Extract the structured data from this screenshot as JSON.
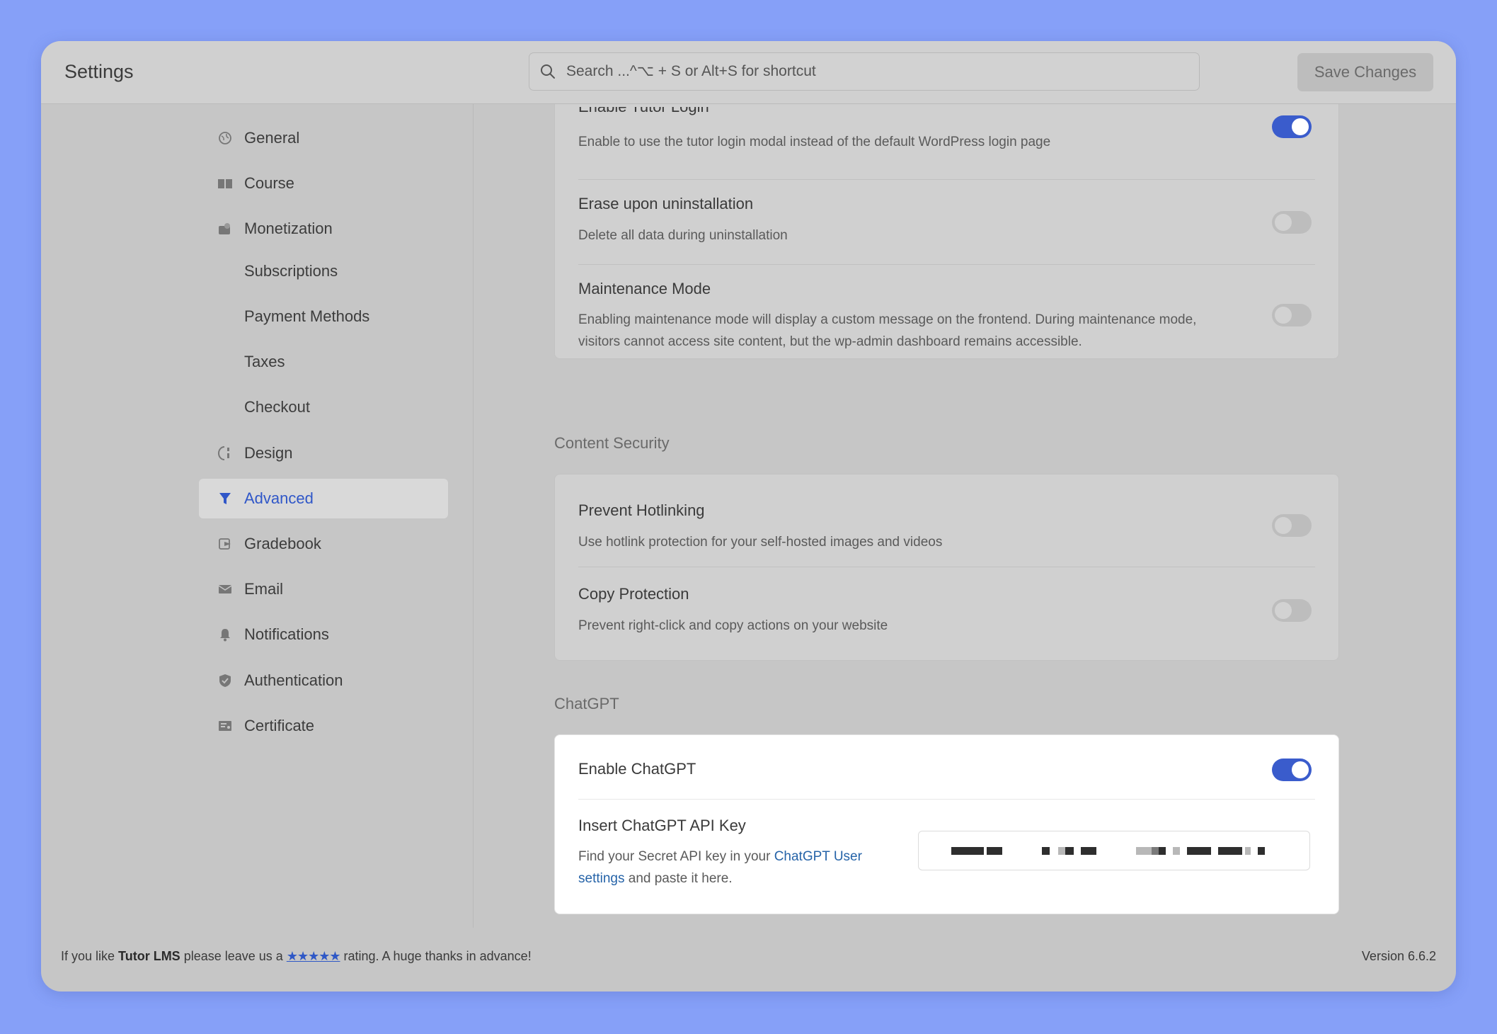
{
  "app": {
    "title": "Settings"
  },
  "search": {
    "placeholder": "Search ...^⌥ + S or Alt+S for shortcut",
    "icon": "search-icon"
  },
  "toolbar": {
    "save_label": "Save Changes"
  },
  "sidebar": {
    "items": [
      {
        "label": "General",
        "icon": "globe-icon",
        "active": false,
        "sub": false
      },
      {
        "label": "Course",
        "icon": "book-icon",
        "active": false,
        "sub": false
      },
      {
        "label": "Monetization",
        "icon": "money-icon",
        "active": false,
        "sub": false
      },
      {
        "label": "Subscriptions",
        "icon": "",
        "active": false,
        "sub": true
      },
      {
        "label": "Payment Methods",
        "icon": "",
        "active": false,
        "sub": true
      },
      {
        "label": "Taxes",
        "icon": "",
        "active": false,
        "sub": true
      },
      {
        "label": "Checkout",
        "icon": "",
        "active": false,
        "sub": true
      },
      {
        "label": "Design",
        "icon": "palette-icon",
        "active": false,
        "sub": false
      },
      {
        "label": "Advanced",
        "icon": "filter-icon",
        "active": true,
        "sub": false
      },
      {
        "label": "Gradebook",
        "icon": "gradebook-icon",
        "active": false,
        "sub": false
      },
      {
        "label": "Email",
        "icon": "envelope-icon",
        "active": false,
        "sub": false
      },
      {
        "label": "Notifications",
        "icon": "bell-icon",
        "active": false,
        "sub": false
      },
      {
        "label": "Authentication",
        "icon": "shield-icon",
        "active": false,
        "sub": false
      },
      {
        "label": "Certificate",
        "icon": "certificate-icon",
        "active": false,
        "sub": false
      }
    ]
  },
  "options_card": {
    "rows": [
      {
        "title": "Enable Tutor Login",
        "desc": "Enable to use the tutor login modal instead of the default WordPress login page",
        "enabled": true
      },
      {
        "title": "Erase upon uninstallation",
        "desc": "Delete all data during uninstallation",
        "enabled": false
      },
      {
        "title": "Maintenance Mode",
        "desc_line1": "Enabling maintenance mode will display a custom message on the frontend. During maintenance mode,",
        "desc_line2": "visitors cannot access site content, but the wp-admin dashboard remains accessible.",
        "enabled": false
      }
    ]
  },
  "content_security": {
    "label": "Content Security",
    "rows": [
      {
        "title": "Prevent Hotlinking",
        "desc": "Use hotlink protection for your self-hosted images and videos",
        "enabled": false
      },
      {
        "title": "Copy Protection",
        "desc": "Prevent right-click and copy actions on your website",
        "enabled": false
      }
    ]
  },
  "chatgpt": {
    "label": "ChatGPT",
    "enable_title": "Enable ChatGPT",
    "enabled": true,
    "api_key_title": "Insert ChatGPT API Key",
    "api_desc_prefix": "Find your Secret API key in your ",
    "api_desc_link1": "ChatGPT User",
    "api_desc_link2": "settings",
    "api_desc_suffix": " and paste it here.",
    "api_key_value": "(redacted)"
  },
  "footer": {
    "text_prefix": "If you like ",
    "brand": "Tutor LMS",
    "text_mid": " please leave us a ",
    "stars": "★★★★★",
    "text_suffix": " rating. A huge thanks in advance!",
    "version": "Version 6.6.2"
  },
  "colors": {
    "accent": "#3a5ccc",
    "background": "#86a0f8",
    "link": "#2563a8"
  }
}
